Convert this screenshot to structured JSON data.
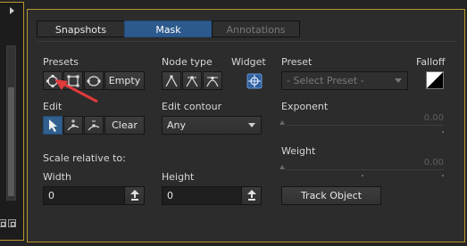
{
  "tabs": [
    {
      "label": "Snapshots",
      "state": "normal"
    },
    {
      "label": "Mask",
      "state": "active"
    },
    {
      "label": "Annotations",
      "state": "disabled"
    }
  ],
  "presets": {
    "label": "Presets",
    "icons": [
      "node-circle-icon",
      "rectangle-node-icon",
      "ellipse-node-icon"
    ],
    "empty_label": "Empty"
  },
  "node_type": {
    "label": "Node type",
    "icons": [
      "corner-node-icon",
      "smooth-node-icon",
      "bezier-node-icon"
    ]
  },
  "widget": {
    "label": "Widget",
    "icon": "widget-icon"
  },
  "preset_select": {
    "label": "Preset",
    "value": "- Select Preset -"
  },
  "falloff": {
    "label": "Falloff",
    "icon": "falloff-gradient-icon"
  },
  "edit": {
    "label": "Edit",
    "icons": [
      "select-arrow-icon",
      "add-node-icon",
      "remove-node-icon"
    ],
    "clear_label": "Clear"
  },
  "edit_contour": {
    "label": "Edit contour",
    "value": "Any"
  },
  "exponent": {
    "label": "Exponent",
    "value": "0.00",
    "level": 0.0
  },
  "weight": {
    "label": "Weight",
    "value": "0.00",
    "level": 0.0
  },
  "scale": {
    "label": "Scale relative to:",
    "width_label": "Width",
    "width_value": "0",
    "height_label": "Height",
    "height_value": "0"
  },
  "track_object_label": "Track Object",
  "colors": {
    "accent": "#2d5a8c",
    "frame": "#b8962e",
    "arrow": "#e03a3a"
  }
}
